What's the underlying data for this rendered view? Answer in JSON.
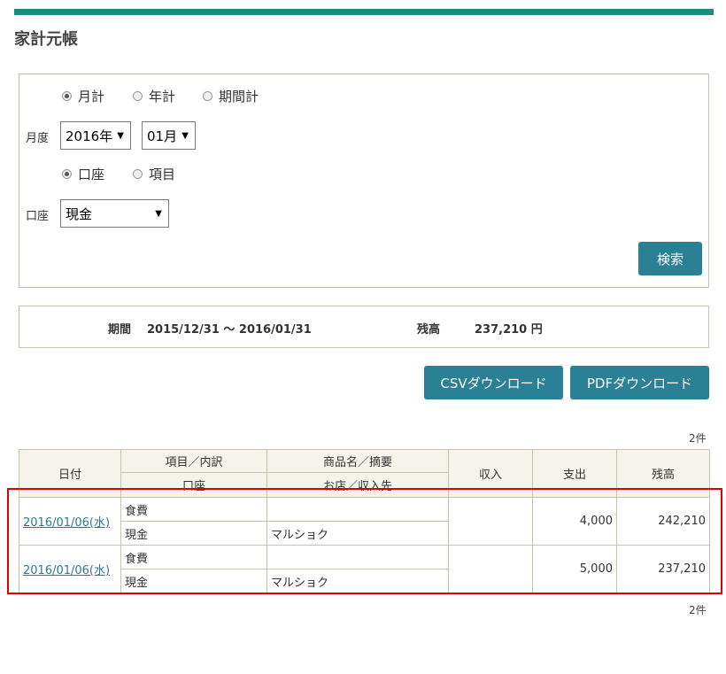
{
  "page": {
    "title": "家計元帳"
  },
  "search": {
    "period_options": [
      "月計",
      "年計",
      "期間計"
    ],
    "month_label": "月度",
    "year_value": "2016年",
    "month_value": "01月",
    "group_options": [
      "口座",
      "項目"
    ],
    "account_label": "口座",
    "account_value": "現金",
    "search_button": "検索"
  },
  "summary": {
    "period_label": "期間",
    "period_value": "2015/12/31 ～ 2016/01/31",
    "balance_label": "残高",
    "balance_value": "237,210 円"
  },
  "downloads": {
    "csv": "CSVダウンロード",
    "pdf": "PDFダウンロード"
  },
  "count_top": "2件",
  "count_bottom": "2件",
  "table": {
    "headers": {
      "date": "日付",
      "item": "項目／内訳",
      "account": "口座",
      "product": "商品名／摘要",
      "shop": "お店／収入先",
      "income": "収入",
      "expense": "支出",
      "balance": "残高"
    },
    "rows": [
      {
        "date": "2016/01/06(水)",
        "item": "食費",
        "account": "現金",
        "product": "",
        "shop": "マルショク",
        "income": "",
        "expense": "4,000",
        "balance": "242,210"
      },
      {
        "date": "2016/01/06(水)",
        "item": "食費",
        "account": "現金",
        "product": "",
        "shop": "マルショク",
        "income": "",
        "expense": "5,000",
        "balance": "237,210"
      }
    ]
  },
  "colors": {
    "accent": "#1e8a80",
    "button": "#2a8196",
    "highlight": "#e00000"
  }
}
